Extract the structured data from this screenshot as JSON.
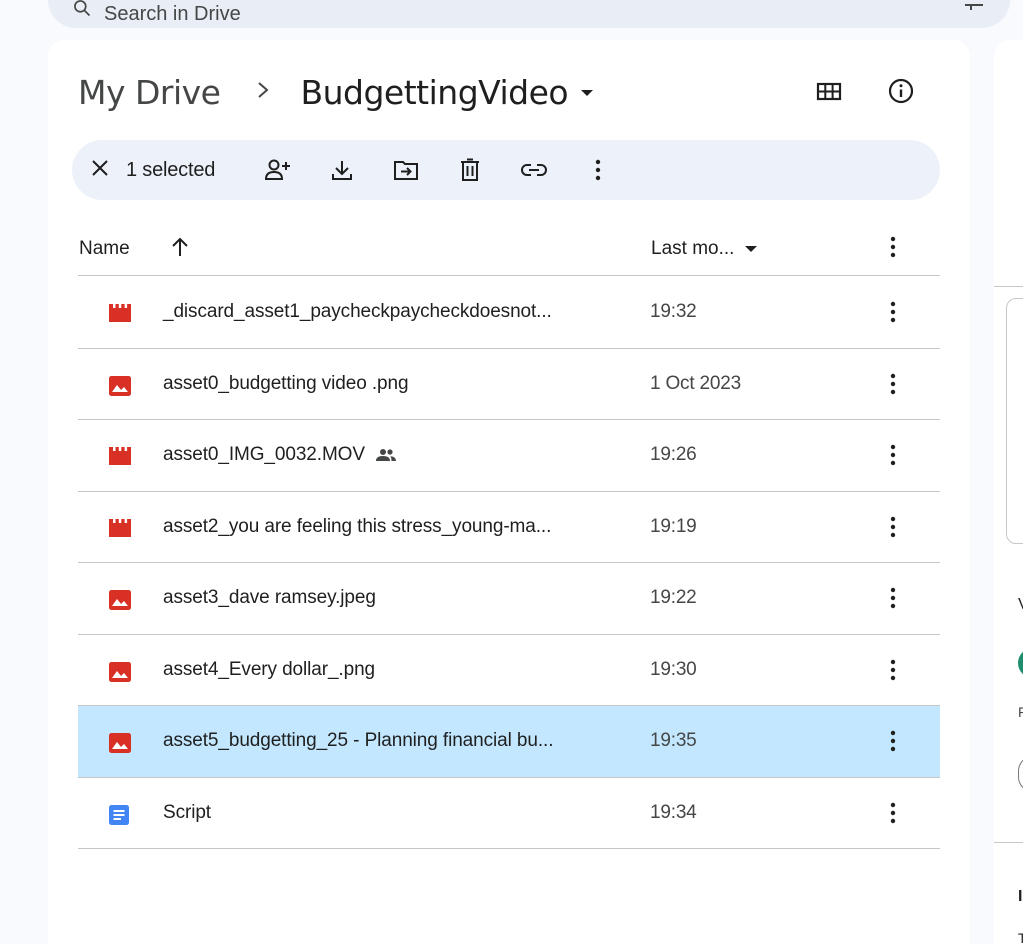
{
  "search": {
    "placeholder": "Search in Drive"
  },
  "breadcrumb": {
    "root": "My Drive",
    "separator": ">",
    "current": "BudgettingVideo"
  },
  "toolbar": {
    "selected_text": "1 selected"
  },
  "table": {
    "header_name": "Name",
    "header_modified": "Last mo...",
    "rows": [
      {
        "name": "_discard_asset1_paycheckpaycheckdoesnot...",
        "modified": "19:32",
        "type": "video",
        "shared": false,
        "selected": false
      },
      {
        "name": "asset0_budgetting video .png",
        "modified": "1 Oct 2023",
        "type": "image",
        "shared": false,
        "selected": false
      },
      {
        "name": "asset0_IMG_0032.MOV",
        "modified": "19:26",
        "type": "video",
        "shared": true,
        "selected": false
      },
      {
        "name": "asset2_you are feeling this stress_young-ma...",
        "modified": "19:19",
        "type": "video",
        "shared": false,
        "selected": false
      },
      {
        "name": "asset3_dave ramsey.jpeg",
        "modified": "19:22",
        "type": "image",
        "shared": false,
        "selected": false
      },
      {
        "name": "asset4_Every dollar_.png",
        "modified": "19:30",
        "type": "image",
        "shared": false,
        "selected": false
      },
      {
        "name": "asset5_budgetting_25 - Planning financial bu...",
        "modified": "19:35",
        "type": "image",
        "shared": false,
        "selected": true
      },
      {
        "name": "Script",
        "modified": "19:34",
        "type": "doc",
        "shared": false,
        "selected": false
      }
    ]
  },
  "colors": {
    "accent_red": "#d93025",
    "doc_blue": "#4285f4",
    "selected_row": "#c2e7ff",
    "toolbar_bg": "#edf2fa"
  }
}
